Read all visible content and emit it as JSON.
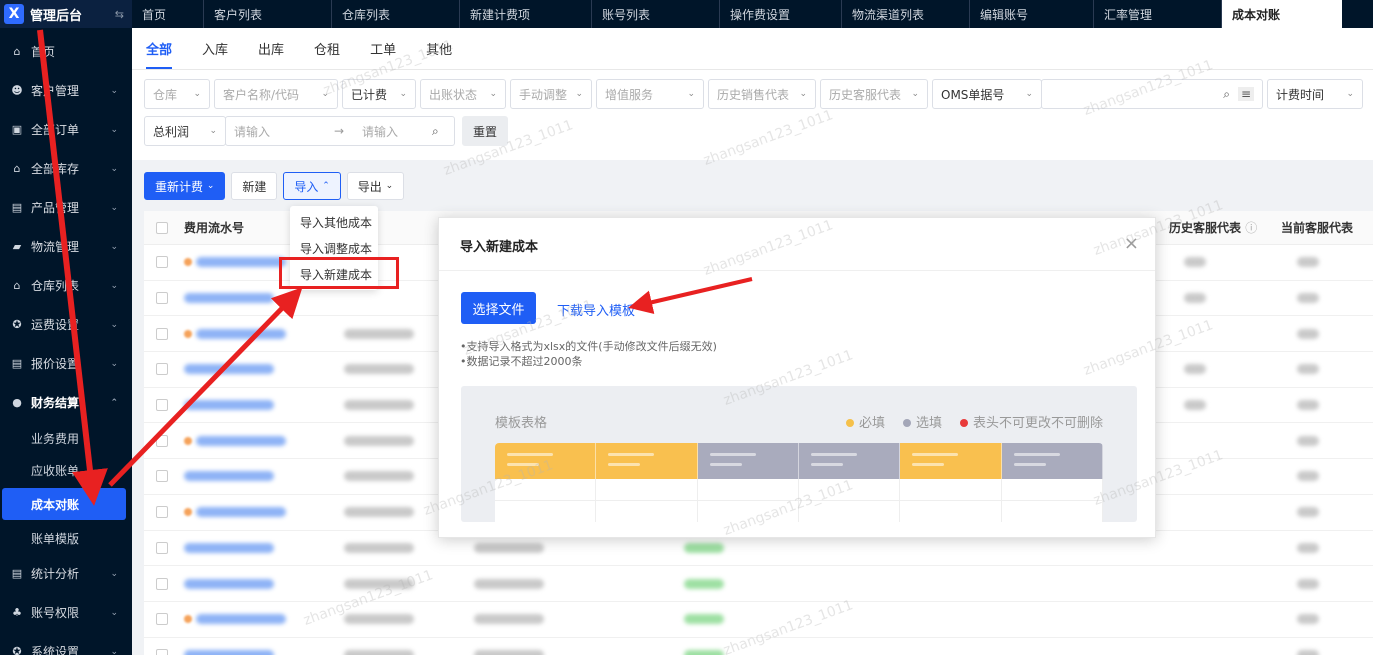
{
  "sidebar": {
    "logo_text": "管理后台",
    "logo_mark": "X",
    "collapse_icon": "⇆",
    "items": [
      {
        "label": "首页",
        "icon": "home-icon",
        "glyph": "⌂"
      },
      {
        "label": "客户管理",
        "icon": "users-icon",
        "glyph": "☻"
      },
      {
        "label": "全部订单",
        "icon": "clipboard-icon",
        "glyph": "▣"
      },
      {
        "label": "全部库存",
        "icon": "warehouse-icon",
        "glyph": "⌂"
      },
      {
        "label": "产品管理",
        "icon": "box-icon",
        "glyph": "▤"
      },
      {
        "label": "物流管理",
        "icon": "truck-icon",
        "glyph": "▰"
      },
      {
        "label": "仓库列表",
        "icon": "warehouse-icon",
        "glyph": "⌂"
      },
      {
        "label": "运费设置",
        "icon": "gear-icon",
        "glyph": "✪"
      },
      {
        "label": "报价设置",
        "icon": "document-icon",
        "glyph": "▤"
      },
      {
        "label": "财务结算",
        "icon": "money-icon",
        "glyph": "●"
      }
    ],
    "finance_sub": [
      {
        "label": "业务费用"
      },
      {
        "label": "应收账单"
      },
      {
        "label": "成本对账"
      },
      {
        "label": "账单模版"
      }
    ],
    "bottom_items": [
      {
        "label": "统计分析",
        "icon": "chart-icon",
        "glyph": "▤"
      },
      {
        "label": "账号权限",
        "icon": "org-icon",
        "glyph": "♣"
      },
      {
        "label": "系统设置",
        "icon": "gear-icon",
        "glyph": "✪"
      }
    ]
  },
  "topbar": {
    "tabs": [
      "首页",
      "客户列表",
      "仓库列表",
      "新建计费项",
      "账号列表",
      "操作费设置",
      "物流渠道列表",
      "编辑账号",
      "汇率管理"
    ],
    "active_tab": "成本对账"
  },
  "subtabs": [
    "全部",
    "入库",
    "出库",
    "仓租",
    "工单",
    "其他"
  ],
  "filters": {
    "row1": [
      "仓库",
      "客户名称/代码",
      "已计费",
      "出账状态",
      "手动调整",
      "增值服务",
      "历史销售代表",
      "历史客服代表",
      "OMS单据号"
    ],
    "billing_time": "计费时间",
    "profit_label": "总利润",
    "from_placeholder": "请输入",
    "to_placeholder": "请输入",
    "range_arrow": "→",
    "reset": "重置"
  },
  "actions": {
    "recalc": "重新计费",
    "new": "新建",
    "import": "导入",
    "export": "导出"
  },
  "table": {
    "col_serial": "费用流水号",
    "col_history_service": "历史客服代表",
    "col_current_service": "当前客服代表"
  },
  "import_menu": [
    "导入其他成本",
    "导入调整成本",
    "导入新建成本"
  ],
  "modal": {
    "title": "导入新建成本",
    "close": "×",
    "select_file": "选择文件",
    "download_template": "下载导入模板",
    "notes": [
      "•支持导入格式为xlsx的文件(手动修改文件后缀无效)",
      "•数据记录不超过2000条"
    ],
    "template_title": "模板表格",
    "legend": [
      {
        "label": "必填",
        "color": "#f5c04a"
      },
      {
        "label": "选填",
        "color": "#a3a6b8"
      },
      {
        "label": "表头不可更改不可删除",
        "color": "#e83a3a"
      }
    ],
    "template_columns": [
      "#f9c04f",
      "#f9c04f",
      "#a9abbd",
      "#a9abbd",
      "#f9c04f",
      "#a9abbd"
    ]
  },
  "watermark": "zhangsan123_1011",
  "colors": {
    "primary": "#1f5ef5",
    "annotation_red": "#e82121"
  }
}
